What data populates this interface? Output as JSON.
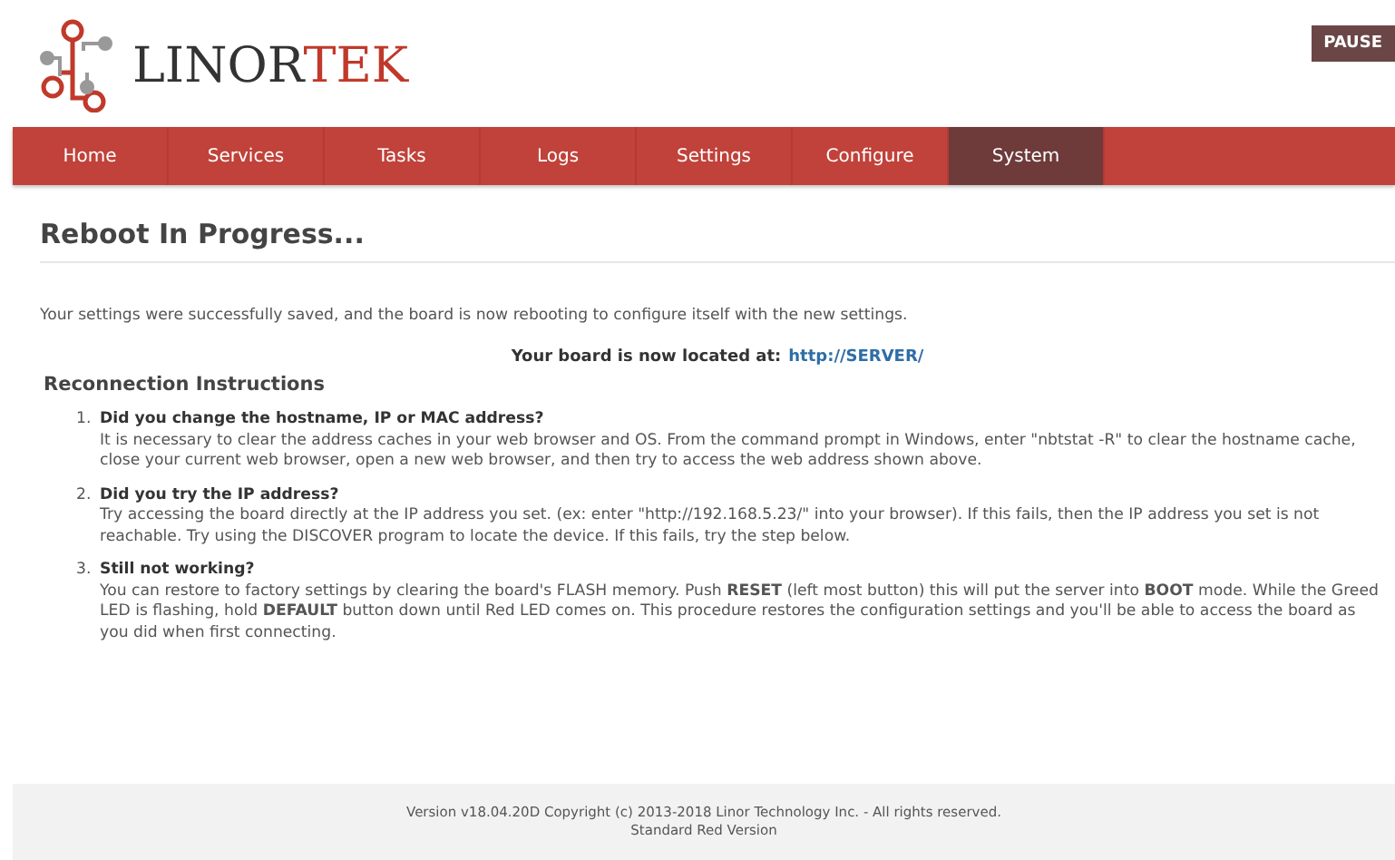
{
  "logo": {
    "dark": "LINOR",
    "accent": "TEK"
  },
  "pause_button": "PAUSE",
  "nav": [
    {
      "label": "Home",
      "selected": false
    },
    {
      "label": "Services",
      "selected": false
    },
    {
      "label": "Tasks",
      "selected": false
    },
    {
      "label": "Logs",
      "selected": false
    },
    {
      "label": "Settings",
      "selected": false
    },
    {
      "label": "Configure",
      "selected": false
    },
    {
      "label": "System",
      "selected": true
    }
  ],
  "title": "Reboot In Progress...",
  "message": "Your settings were successfully saved, and the board is now rebooting to configure itself with the new settings.",
  "location": {
    "label": "Your board is now located at:",
    "link": "http://SERVER/"
  },
  "instructions_heading": "Reconnection Instructions",
  "instructions": [
    {
      "number": "1.",
      "question": "Did you change the hostname, IP or MAC address?",
      "answer": "It is necessary to clear the address caches in your web browser and OS. From the command prompt in Windows, enter \"nbtstat -R\" to clear the hostname cache, close your current web browser, open a new web browser, and then try to access the web address shown above."
    },
    {
      "number": "2.",
      "question": "Did you try the IP address?",
      "answer": "Try accessing the board directly at the IP address you set. (ex: enter \"http://192.168.5.23/\" into your browser). If this fails, then the IP address you set is not reachable. Try using the DISCOVER program to locate the device. If this fails, try the step below."
    },
    {
      "number": "3.",
      "question": "Still not working?",
      "answer": "You can restore to factory settings by clearing the board's FLASH memory. Push **RESET** (left most button) this will put the server into **BOOT** mode. While the Greed LED is flashing, hold **DEFAULT** button down until Red LED comes on. This procedure restores the configuration settings and you'll be able to access the board as you did when first connecting."
    }
  ],
  "footer": [
    "Version v18.04.20D Copyright (c) 2013-2018 Linor Technology Inc. - All rights reserved.",
    "Standard Red Version"
  ]
}
